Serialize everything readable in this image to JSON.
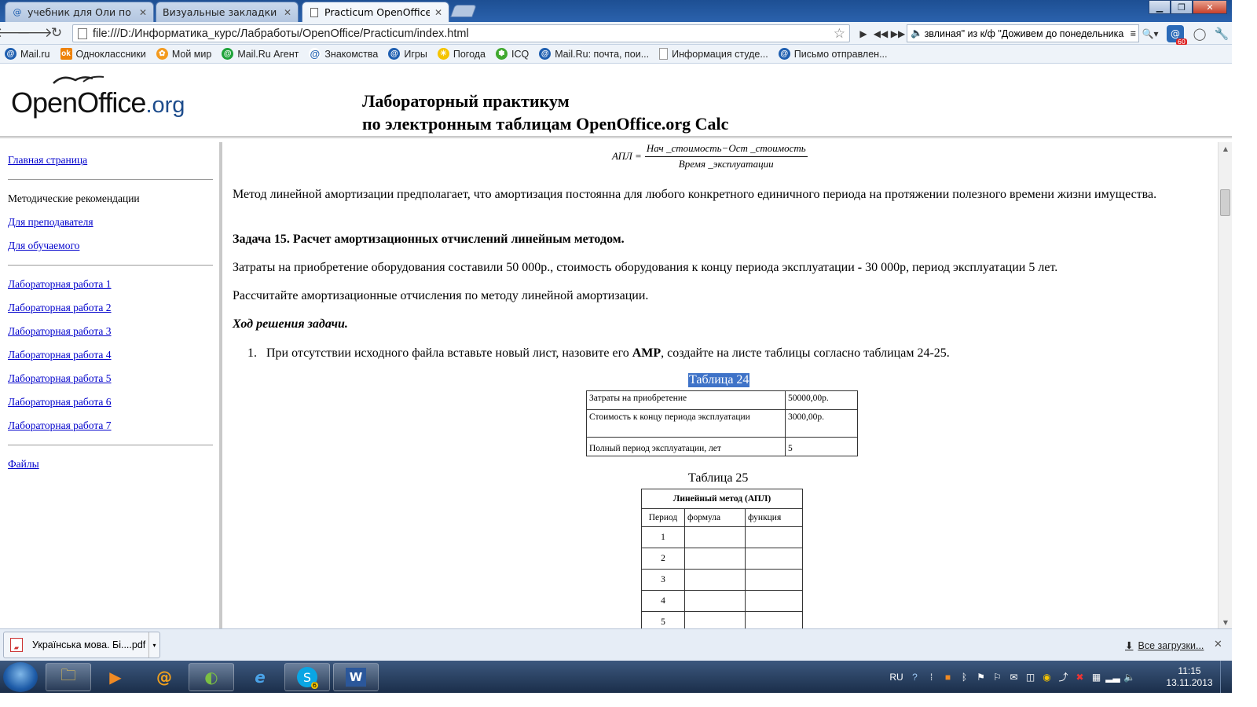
{
  "browser": {
    "tabs": [
      {
        "title": "учебник для Оли по укра",
        "active": false
      },
      {
        "title": "Визуальные закладки",
        "active": false
      },
      {
        "title": "Practicum OpenOffice.org",
        "active": true
      }
    ],
    "url": "file:///D:/Информатика_курс/Лабработы/OpenOffice/Practicum/index.html",
    "media_ticker": "звлиная\" из к/ф \"Доживем до понедельника",
    "notification_badge": "60",
    "bookmarks": [
      {
        "label": "Mail.ru",
        "icon": "mailru-icon",
        "color": "#1f5fb0"
      },
      {
        "label": "Одноклассники",
        "icon": "ok-icon",
        "color": "#ee8208"
      },
      {
        "label": "Мой мир",
        "icon": "moimir-icon",
        "color": "#f39a1e"
      },
      {
        "label": "Mail.Ru Агент",
        "icon": "agent-icon",
        "color": "#1fa33a"
      },
      {
        "label": "Знакомства",
        "icon": "at-icon",
        "color": "#1f5fb0"
      },
      {
        "label": "Игры",
        "icon": "games-icon",
        "color": "#1f5fb0"
      },
      {
        "label": "Погода",
        "icon": "weather-icon",
        "color": "#f5c400"
      },
      {
        "label": "ICQ",
        "icon": "icq-icon",
        "color": "#3fa82e"
      },
      {
        "label": "Mail.Ru: почта, пои...",
        "icon": "mailru-icon",
        "color": "#1f5fb0"
      },
      {
        "label": "Информация студе...",
        "icon": "page-icon",
        "color": "#9a9a9a"
      },
      {
        "label": "Письмо отправлен...",
        "icon": "mailru-icon",
        "color": "#1f5fb0"
      }
    ]
  },
  "page": {
    "logo_main": "OpenOffice",
    "logo_suffix": ".org",
    "title_line1": "Лабораторный практикум",
    "title_line2": "по электронным таблицам OpenOffice.org Calc"
  },
  "nav": {
    "home": "Главная страница",
    "methods": "Методические рекомендации",
    "teacher": "Для преподавателя",
    "student": "Для обучаемого",
    "labs": [
      "Лабораторная работа 1",
      "Лабораторная работа 2",
      "Лабораторная работа 3",
      "Лабораторная работа 4",
      "Лабораторная работа 5",
      "Лабораторная работа 6",
      "Лабораторная работа 7"
    ],
    "files": "Файлы"
  },
  "content": {
    "formula_lhs": "АПЛ =",
    "formula_num": "Нач _стоимость−Ост _стоимость",
    "formula_den": "Время _эксплуатации",
    "p1": "Метод линейной амортизации предполагает, что амортизация постоянна для любого конкретного единичного периода на протяжении полезного времени жизни имущества.",
    "task_title": "Задача 15. Расчет амортизационных отчислений линейным методом.",
    "p2_a": "Затраты на приобретение оборудования составили 50 000р., стоимость оборудования к концу периода эксплуатации ",
    "p2_dash": "-",
    "p2_b": " 30 000р, период эксплуатации 5 лет.",
    "p3": "Рассчитайте амортизационные отчисления по методу линейной амортизации.",
    "solution_title": "Ход решения задачи.",
    "step1_num": "1.",
    "step1_a": "При отсутствии исходного файла вставьте новый лист, назовите его ",
    "step1_bold": "АМР",
    "step1_b": ", создайте на листе таблицы согласно таблицам 24-25.",
    "table24_caption": "Таблица 24",
    "table24_rows": [
      {
        "label": "Затраты на приобретение",
        "value": "50000,00р."
      },
      {
        "label": "Стоимость к концу периода эксплуатации",
        "value": "3000,00р."
      },
      {
        "label": "Полный период эксплуатации, лет",
        "value": "5"
      }
    ],
    "table25_caption": "Таблица 25",
    "table25_header": "Линейный метод (АПЛ)",
    "table25_cols": [
      "Период",
      "формула",
      "функция"
    ],
    "table25_periods": [
      "1",
      "2",
      "3",
      "4",
      "5"
    ]
  },
  "downloads": {
    "file": "Українська мова. Бі....pdf",
    "all": "Все загрузки..."
  },
  "taskbar": {
    "lang": "RU",
    "time": "11:15",
    "date": "13.11.2013",
    "skype_badge": "6"
  }
}
